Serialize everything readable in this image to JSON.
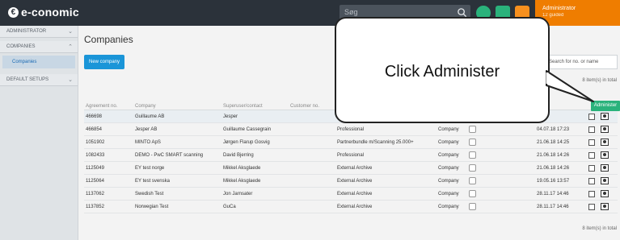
{
  "brand": {
    "name": "e-conomic"
  },
  "topbar": {
    "search_placeholder": "Søg",
    "user_name": "Administrator",
    "user_sub": "12 guided"
  },
  "sidebar": {
    "sections": [
      {
        "label": "ADMINISTRATOR"
      },
      {
        "label": "COMPANIES"
      },
      {
        "label": "DEFAULT SETUPS"
      }
    ],
    "active_item": "Companies"
  },
  "main": {
    "title": "Companies",
    "new_button": "New company",
    "search_placeholder": "Search for no. or name",
    "items_count": "8 item(s) in total",
    "administer_button": "Administer"
  },
  "table": {
    "headers": [
      "Agreement no.",
      "Company",
      "Superuser/contact",
      "Customer no."
    ],
    "rows": [
      {
        "no": "466698",
        "company": "Guillaume AB",
        "contact": "Jesper",
        "package": "",
        "type": "",
        "date": "11:36"
      },
      {
        "no": "466854",
        "company": "Jesper AB",
        "contact": "Guillaume Cassegrain",
        "package": "Professional",
        "type": "Company",
        "date": "04.07.18 17:23"
      },
      {
        "no": "1051902",
        "company": "MINTO ApS",
        "contact": "Jørgen Flarup Gosvig",
        "package": "Partnerbundle m/Scanning 25.000+",
        "type": "Company",
        "date": "21.06.18 14:25"
      },
      {
        "no": "1082433",
        "company": "DEMO - PwC SMART scanning",
        "contact": "David Bjerring",
        "package": "Professional",
        "type": "Company",
        "date": "21.06.18 14:26"
      },
      {
        "no": "1125049",
        "company": "EY test norge",
        "contact": "Mikkel Aksglaede",
        "package": "External Archive",
        "type": "Company",
        "date": "21.06.18 14:26"
      },
      {
        "no": "1125064",
        "company": "EY test svenska",
        "contact": "Mikkel Aksglaede",
        "package": "External Archive",
        "type": "Company",
        "date": "19.05.16 13:57"
      },
      {
        "no": "1137062",
        "company": "Swedish Test",
        "contact": "Jon Jarnsater",
        "package": "External Archive",
        "type": "Company",
        "date": "28.11.17 14:46"
      },
      {
        "no": "1137852",
        "company": "Norwegian Test",
        "contact": "GuCa",
        "package": "External Archive",
        "type": "Company",
        "date": "28.11.17 14:46"
      }
    ]
  },
  "callout": {
    "text": "Click Administer"
  }
}
